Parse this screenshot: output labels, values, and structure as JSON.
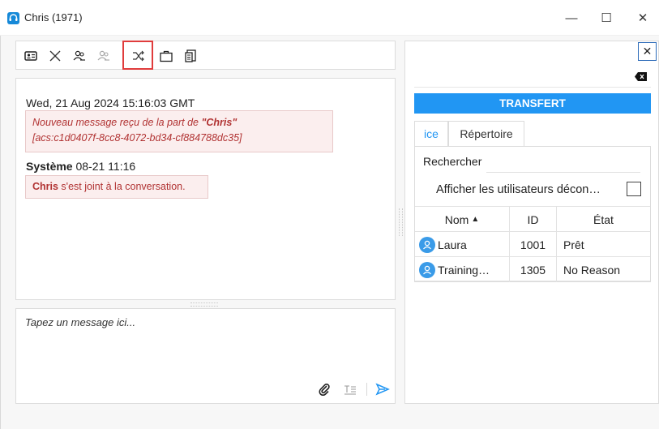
{
  "window": {
    "title": "Chris (1971)",
    "minimize_glyph": "—",
    "maximize_glyph": "☐",
    "close_glyph": "✕"
  },
  "toolbar": {
    "tools": [
      {
        "name": "contact-card-icon"
      },
      {
        "name": "hangup-x-icon"
      },
      {
        "name": "users-icon"
      },
      {
        "name": "users-disabled-icon"
      },
      {
        "name": "transfer-shuffle-icon",
        "highlighted": true
      },
      {
        "name": "briefcase-icon"
      },
      {
        "name": "document-stack-icon"
      }
    ]
  },
  "conversation": {
    "timestamp": "Wed, 21 Aug 2024 15:16:03 GMT",
    "message1_prefix": "Nouveau message reçu de la part de ",
    "message1_name": "\"Chris\"",
    "message1_id": "[acs:c1d0407f-8cc8-4072-bd34-cf884788dc35]",
    "system_sender": "Système",
    "system_time": "08-21 11:16",
    "system_name": "Chris",
    "system_text": " s'est joint à la conversation."
  },
  "compose": {
    "placeholder": "Tapez un message ici..."
  },
  "transfer_panel": {
    "close_glyph": "✕",
    "header": "TRANSFERT",
    "tabs": [
      "ice",
      "Répertoire"
    ],
    "active_tab": "ice",
    "search_label": "Rechercher",
    "show_offline_label": "Afficher les utilisateurs décon…",
    "show_offline_checked": false,
    "columns": [
      "Nom",
      "ID",
      "État"
    ],
    "sort_glyph": "▲",
    "rows": [
      {
        "name": "Laura",
        "id": "1001",
        "state": "Prêt"
      },
      {
        "name": "Training…",
        "id": "1305",
        "state": "No Reason"
      }
    ]
  },
  "colors": {
    "accent": "#2196f3",
    "highlight_border": "#e03c3c",
    "message_bg": "#fbeeee",
    "message_text": "#b13333"
  }
}
